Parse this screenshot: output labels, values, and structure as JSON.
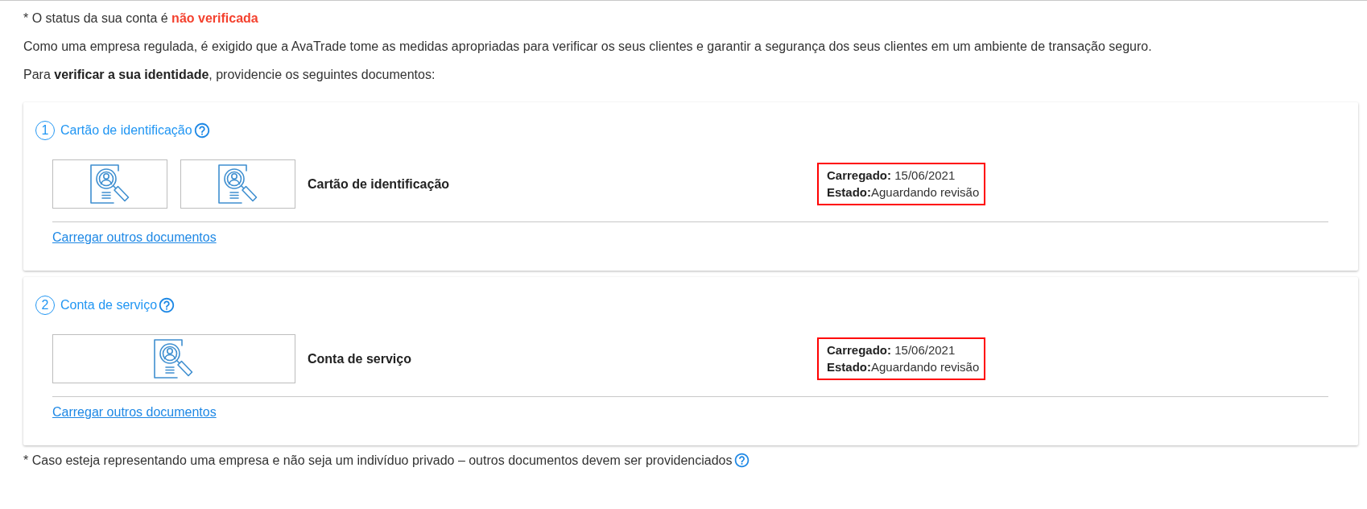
{
  "account_status": "* O status da sua conta é **não verificada**",
  "intro": "Como uma empresa regulada, é exigido que a AvaTrade tome as medidas apropriadas para verificar os seus clientes e garantir a segurança dos seus clientes em um ambiente de transação seguro.",
  "instruction": "Para **verificar a sua identidade**, providencie os seguintes documentos:",
  "sections": [
    {
      "number": "1",
      "title": "Cartão de identificação",
      "tiles": [
        {
          "kind": "narrow"
        },
        {
          "kind": "narrow"
        }
      ],
      "document_name": "Cartão de identificação",
      "uploaded": "**Carregado:** 15/06/2021",
      "state": "**Estado:**Aguardando revisão",
      "highlighted": true,
      "link": "Carregar outros documentos"
    },
    {
      "number": "2",
      "title": "Conta de serviço",
      "tiles": [
        {
          "kind": "wide"
        }
      ],
      "document_name": "Conta de serviço",
      "uploaded": "**Carregado:** 15/06/2021",
      "state": "**Estado:**Aguardando revisão",
      "highlighted": true,
      "link": "Carregar outros documentos"
    }
  ],
  "footnote": "* Caso esteja representando uma empresa e não seja um indivíduo privado – outros documentos devem ser providenciados"
}
